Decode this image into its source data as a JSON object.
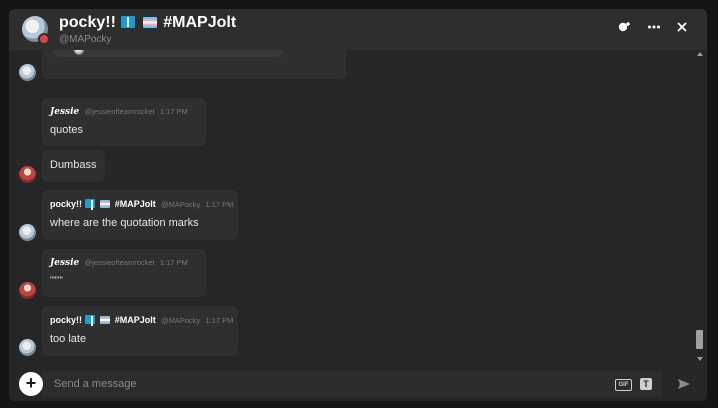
{
  "header": {
    "title_name": "pocky!!",
    "title_tag": "#MAPJolt",
    "handle": "@MAPocky",
    "add_friend_icon": "person-plus-icon",
    "more_icon": "ellipsis-icon",
    "close_icon": "close-icon"
  },
  "messages": [
    {
      "author": "Jessie",
      "handle": "@jessieofteamrocket",
      "time": "1:17 PM",
      "text": "quotes"
    },
    {
      "author": "",
      "handle": "",
      "time": "",
      "text": "Dumbass"
    },
    {
      "author": "pocky!!",
      "tag": "#MAPJolt",
      "handle": "@MAPocky",
      "time": "1:17 PM",
      "text": "where are the quotation marks"
    },
    {
      "author": "Jessie",
      "handle": "@jessieofteamrocket",
      "time": "1:17 PM",
      "text": "\"\"\"\""
    },
    {
      "author": "pocky!!",
      "tag": "#MAPJolt",
      "handle": "@MAPocky",
      "time": "1:17 PM",
      "text": "too late"
    }
  ],
  "composer": {
    "placeholder": "Send a message",
    "gif_label": "GIF",
    "sticker_icon": "sticker-icon",
    "send_icon": "send-icon",
    "attach_icon": "plus-icon"
  },
  "colors": {
    "background": "#151515",
    "window": "#262626",
    "header": "#2e2e2e",
    "bubble": "#2f2f2f",
    "status_dnd": "#e0404c"
  }
}
